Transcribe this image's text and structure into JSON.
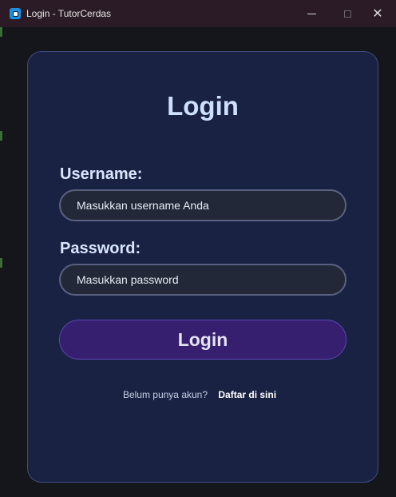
{
  "window": {
    "title": "Login - TutorCerdas",
    "controls": {
      "minimize": "minimize-icon",
      "maximize": "maximize-icon",
      "close": "close-icon"
    }
  },
  "login": {
    "title": "Login",
    "username_label": "Username:",
    "username_placeholder": "Masukkan username Anda",
    "username_value": "",
    "password_label": "Password:",
    "password_placeholder": "Masukkan password",
    "password_value": "",
    "submit_label": "Login",
    "register_prompt": "Belum punya akun?",
    "register_link": "Daftar di sini"
  },
  "colors": {
    "background": "#14161c",
    "card": "#1a2244",
    "card_border": "#3f4c83",
    "title_text": "#cfe0ff",
    "input_bg": "#232838",
    "input_border": "#5a6180",
    "button_bg": "#351f6e",
    "button_border": "#5b47b8",
    "titlebar": "#2a1b26"
  }
}
